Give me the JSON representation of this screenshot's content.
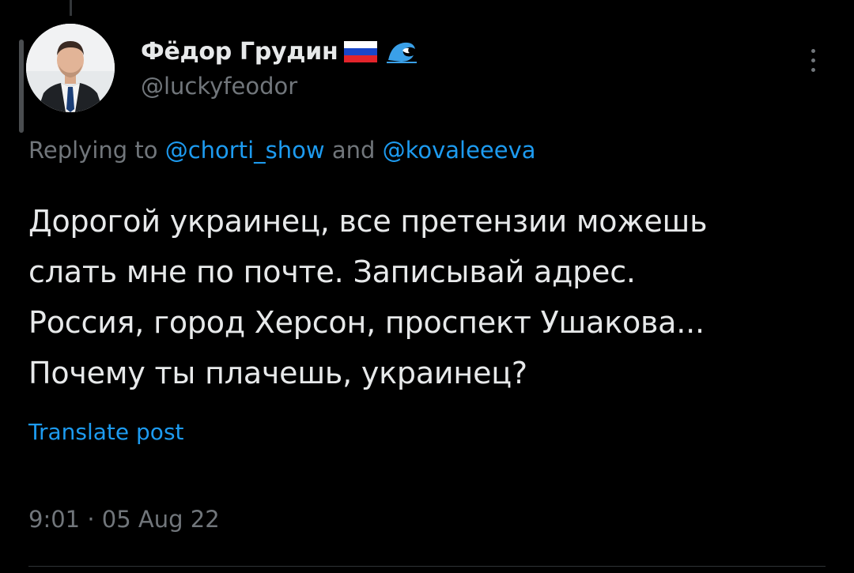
{
  "tweet": {
    "author": {
      "display_name": "Фёдор Грудин",
      "handle": "@luckyfeodor",
      "badges": [
        "russian-flag-icon",
        "water-wave-icon"
      ]
    },
    "reply_context": {
      "prefix": "Replying to",
      "mentions": [
        "@chorti_show",
        "@kovaleeeva"
      ],
      "joiner": "and"
    },
    "text_lines": [
      "Дорогой украинец, все претензии можешь",
      "слать мне по почте. Записывай адрес.",
      "Россия, город Херсон, проспект Ушакова...",
      "Почему ты плачешь, украинец?"
    ],
    "translate_label": "Translate post",
    "timestamp": "9:01 · 05 Aug 22"
  },
  "colors": {
    "background": "#000000",
    "text_primary": "#e7e9ea",
    "text_secondary": "#71767b",
    "accent": "#1d9bf0"
  }
}
